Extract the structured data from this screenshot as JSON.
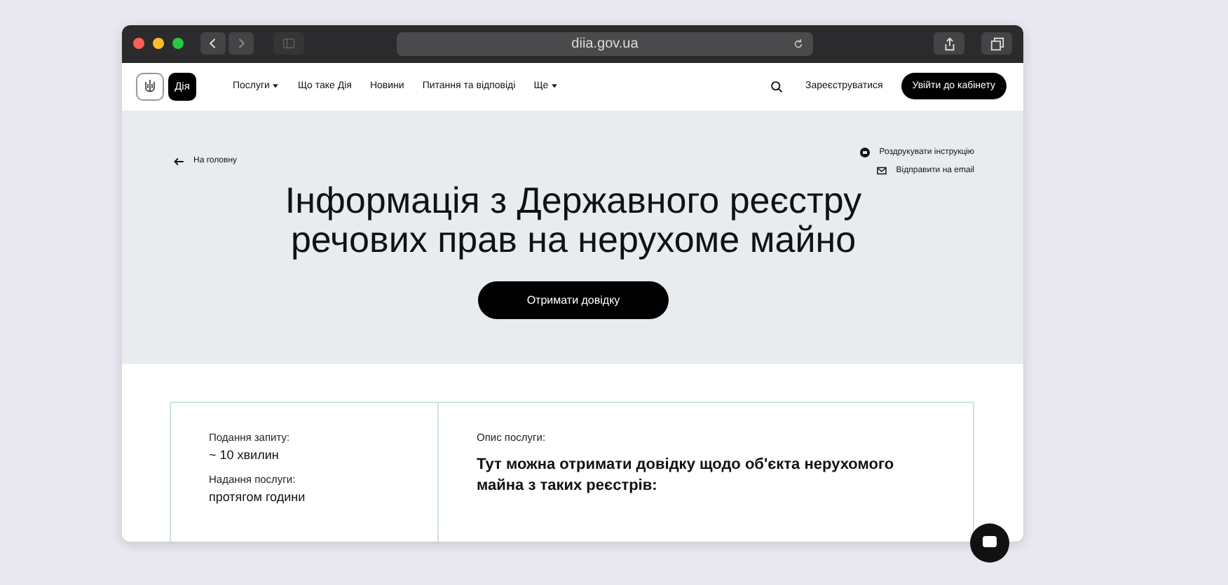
{
  "browser": {
    "address": "diia.gov.ua"
  },
  "nav": {
    "logo_text": "Дія",
    "items": [
      {
        "label": "Послуги",
        "dropdown": true
      },
      {
        "label": "Що таке Дія",
        "dropdown": false
      },
      {
        "label": "Новини",
        "dropdown": false
      },
      {
        "label": "Питання та відповіді",
        "dropdown": false
      },
      {
        "label": "Ще",
        "dropdown": true
      }
    ],
    "register": "Зареєструватися",
    "login": "Увійти до кабінету"
  },
  "hero": {
    "back": "На головну",
    "actions": [
      {
        "kind": "print",
        "label": "Роздрукувати інструкцію"
      },
      {
        "kind": "email",
        "label": "Відправити на email"
      }
    ],
    "title": "Інформація з Державного реєстру речових прав на нерухоме майно",
    "button": "Отримати довідку"
  },
  "info": {
    "facts": [
      {
        "label": "Подання запиту:",
        "value": "~ 10 хвилин"
      },
      {
        "label": "Надання послуги:",
        "value": "протягом години"
      }
    ],
    "description_label": "Опис послуги:",
    "description": "Тут можна отримати довідку щодо об'єкта нерухомого майна з таких реєстрів:"
  }
}
